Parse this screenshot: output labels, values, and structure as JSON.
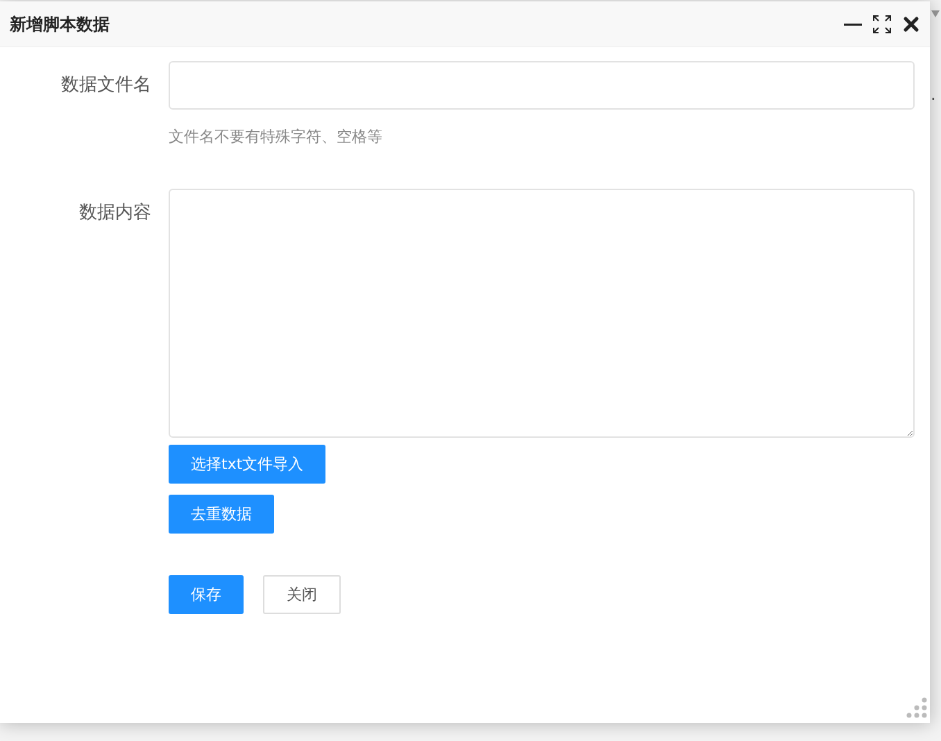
{
  "window": {
    "title": "新增脚本数据"
  },
  "background_text": ".",
  "form": {
    "fields": [
      {
        "kind": "input",
        "label": "数据文件名",
        "hint": "文件名不要有特殊字符、空格等"
      },
      {
        "kind": "textarea",
        "label": "数据内容"
      }
    ],
    "tool_buttons": [
      "选择txt文件导入",
      "去重数据"
    ],
    "actions": [
      {
        "label": "保存",
        "primary": true
      },
      {
        "label": "关闭",
        "primary": false
      }
    ]
  }
}
